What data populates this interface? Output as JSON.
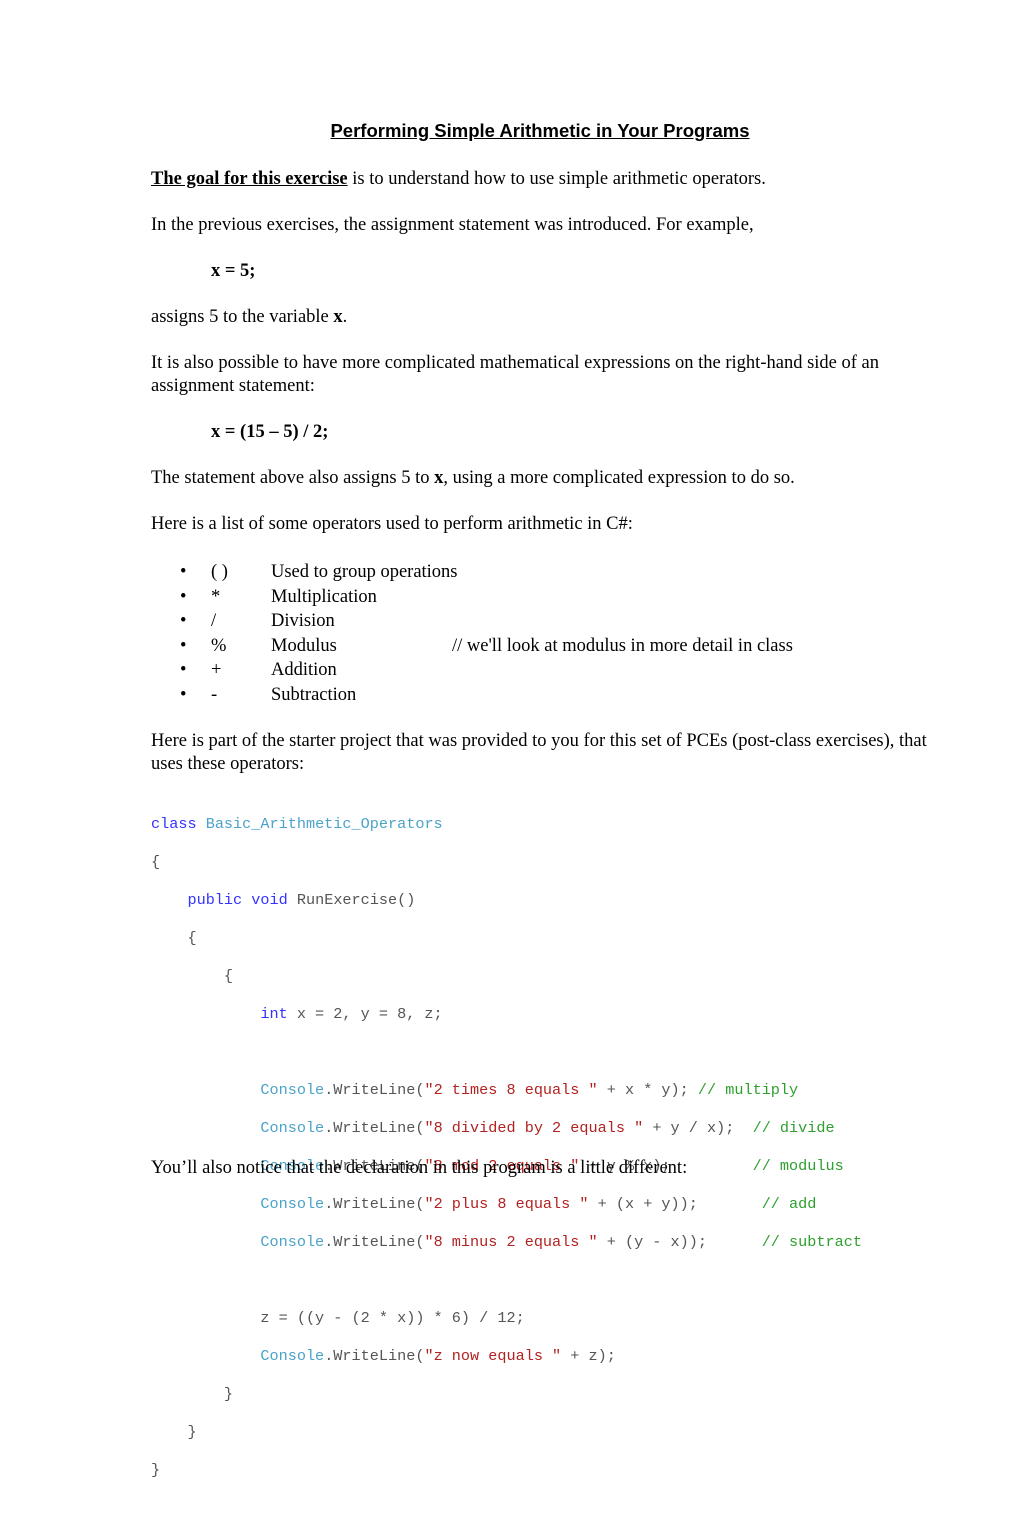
{
  "title": "Performing Simple Arithmetic in Your Programs",
  "goal": {
    "lead": "The goal for this exercise",
    "rest": " is to understand how to use simple arithmetic operators."
  },
  "intro": "In the previous exercises, the assignment statement was introduced.  For example,",
  "example1": "x = 5;",
  "assigns": {
    "pre": "assigns 5 to the variable ",
    "var": "x",
    "post": "."
  },
  "complicated": "It is also possible to have more complicated mathematical expressions on the right-hand side of an assignment statement:",
  "example2": "x = (15 – 5) / 2;",
  "statement_above": {
    "pre": "The statement above also assigns 5 to ",
    "var": "x",
    "post": ", using a more complicated expression to do so."
  },
  "list_intro": "Here is a list of some operators used to perform arithmetic in C#:",
  "operators": [
    {
      "bullet": "•",
      "symbol": "( )",
      "description": "Used to group operations",
      "note": ""
    },
    {
      "bullet": "•",
      "symbol": "*",
      "description": "Multiplication",
      "note": ""
    },
    {
      "bullet": "•",
      "symbol": "/",
      "description": "Division",
      "note": ""
    },
    {
      "bullet": "•",
      "symbol": "%",
      "description": "Modulus",
      "note": "// we'll look at modulus in more detail in class"
    },
    {
      "bullet": "•",
      "symbol": "+",
      "description": "Addition",
      "note": ""
    },
    {
      "bullet": "•",
      "symbol": "-",
      "description": "Subtraction",
      "note": ""
    }
  ],
  "starter_intro": "Here is part of the starter project that was provided to you for this set of PCEs (post-class exercises), that uses these operators:",
  "code": {
    "class_kw": "class",
    "class_name": "Basic_Arithmetic_Operators",
    "open_brace": "{",
    "close_brace": "}",
    "public_kw": "public",
    "void_kw": "void",
    "method": " RunExercise()",
    "int_kw": "int",
    "decl": " x = 2, y = 8, z;",
    "console": "Console",
    "writeline": ".WriteLine(",
    "lines": [
      {
        "str": "\"2 times 8 equals \"",
        "expr": " + x * y); ",
        "comment": "// multiply"
      },
      {
        "str": "\"8 divided by 2 equals \"",
        "expr": " + y / x);  ",
        "comment": "// divide"
      },
      {
        "str": "\"8 mod 2 equals \"",
        "expr": " + y % x);         ",
        "comment": "// modulus"
      },
      {
        "str": "\"2 plus 8 equals \"",
        "expr": " + (x + y));       ",
        "comment": "// add"
      },
      {
        "str": "\"8 minus 2 equals \"",
        "expr": " + (y - x));      ",
        "comment": "// subtract"
      }
    ],
    "z_assign": "z = ((y - (2 * x)) * 6) / 12;",
    "z_str": "\"z now equals \"",
    "z_expr": " + z);"
  },
  "closing": "You’ll also notice that the declaration in this program is a little different:"
}
